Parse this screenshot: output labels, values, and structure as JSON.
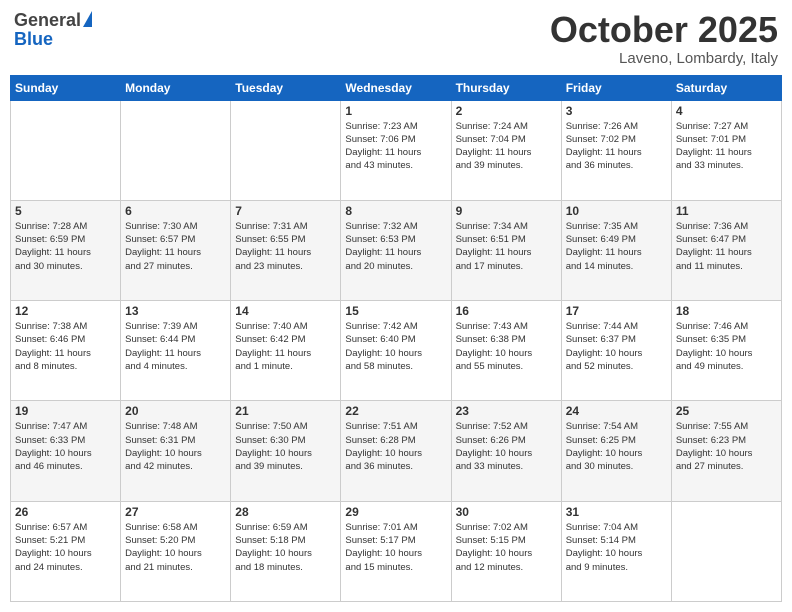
{
  "header": {
    "logo_general": "General",
    "logo_blue": "Blue",
    "month_title": "October 2025",
    "location": "Laveno, Lombardy, Italy"
  },
  "weekdays": [
    "Sunday",
    "Monday",
    "Tuesday",
    "Wednesday",
    "Thursday",
    "Friday",
    "Saturday"
  ],
  "weeks": [
    [
      {
        "day": "",
        "info": ""
      },
      {
        "day": "",
        "info": ""
      },
      {
        "day": "",
        "info": ""
      },
      {
        "day": "1",
        "info": "Sunrise: 7:23 AM\nSunset: 7:06 PM\nDaylight: 11 hours\nand 43 minutes."
      },
      {
        "day": "2",
        "info": "Sunrise: 7:24 AM\nSunset: 7:04 PM\nDaylight: 11 hours\nand 39 minutes."
      },
      {
        "day": "3",
        "info": "Sunrise: 7:26 AM\nSunset: 7:02 PM\nDaylight: 11 hours\nand 36 minutes."
      },
      {
        "day": "4",
        "info": "Sunrise: 7:27 AM\nSunset: 7:01 PM\nDaylight: 11 hours\nand 33 minutes."
      }
    ],
    [
      {
        "day": "5",
        "info": "Sunrise: 7:28 AM\nSunset: 6:59 PM\nDaylight: 11 hours\nand 30 minutes."
      },
      {
        "day": "6",
        "info": "Sunrise: 7:30 AM\nSunset: 6:57 PM\nDaylight: 11 hours\nand 27 minutes."
      },
      {
        "day": "7",
        "info": "Sunrise: 7:31 AM\nSunset: 6:55 PM\nDaylight: 11 hours\nand 23 minutes."
      },
      {
        "day": "8",
        "info": "Sunrise: 7:32 AM\nSunset: 6:53 PM\nDaylight: 11 hours\nand 20 minutes."
      },
      {
        "day": "9",
        "info": "Sunrise: 7:34 AM\nSunset: 6:51 PM\nDaylight: 11 hours\nand 17 minutes."
      },
      {
        "day": "10",
        "info": "Sunrise: 7:35 AM\nSunset: 6:49 PM\nDaylight: 11 hours\nand 14 minutes."
      },
      {
        "day": "11",
        "info": "Sunrise: 7:36 AM\nSunset: 6:47 PM\nDaylight: 11 hours\nand 11 minutes."
      }
    ],
    [
      {
        "day": "12",
        "info": "Sunrise: 7:38 AM\nSunset: 6:46 PM\nDaylight: 11 hours\nand 8 minutes."
      },
      {
        "day": "13",
        "info": "Sunrise: 7:39 AM\nSunset: 6:44 PM\nDaylight: 11 hours\nand 4 minutes."
      },
      {
        "day": "14",
        "info": "Sunrise: 7:40 AM\nSunset: 6:42 PM\nDaylight: 11 hours\nand 1 minute."
      },
      {
        "day": "15",
        "info": "Sunrise: 7:42 AM\nSunset: 6:40 PM\nDaylight: 10 hours\nand 58 minutes."
      },
      {
        "day": "16",
        "info": "Sunrise: 7:43 AM\nSunset: 6:38 PM\nDaylight: 10 hours\nand 55 minutes."
      },
      {
        "day": "17",
        "info": "Sunrise: 7:44 AM\nSunset: 6:37 PM\nDaylight: 10 hours\nand 52 minutes."
      },
      {
        "day": "18",
        "info": "Sunrise: 7:46 AM\nSunset: 6:35 PM\nDaylight: 10 hours\nand 49 minutes."
      }
    ],
    [
      {
        "day": "19",
        "info": "Sunrise: 7:47 AM\nSunset: 6:33 PM\nDaylight: 10 hours\nand 46 minutes."
      },
      {
        "day": "20",
        "info": "Sunrise: 7:48 AM\nSunset: 6:31 PM\nDaylight: 10 hours\nand 42 minutes."
      },
      {
        "day": "21",
        "info": "Sunrise: 7:50 AM\nSunset: 6:30 PM\nDaylight: 10 hours\nand 39 minutes."
      },
      {
        "day": "22",
        "info": "Sunrise: 7:51 AM\nSunset: 6:28 PM\nDaylight: 10 hours\nand 36 minutes."
      },
      {
        "day": "23",
        "info": "Sunrise: 7:52 AM\nSunset: 6:26 PM\nDaylight: 10 hours\nand 33 minutes."
      },
      {
        "day": "24",
        "info": "Sunrise: 7:54 AM\nSunset: 6:25 PM\nDaylight: 10 hours\nand 30 minutes."
      },
      {
        "day": "25",
        "info": "Sunrise: 7:55 AM\nSunset: 6:23 PM\nDaylight: 10 hours\nand 27 minutes."
      }
    ],
    [
      {
        "day": "26",
        "info": "Sunrise: 6:57 AM\nSunset: 5:21 PM\nDaylight: 10 hours\nand 24 minutes."
      },
      {
        "day": "27",
        "info": "Sunrise: 6:58 AM\nSunset: 5:20 PM\nDaylight: 10 hours\nand 21 minutes."
      },
      {
        "day": "28",
        "info": "Sunrise: 6:59 AM\nSunset: 5:18 PM\nDaylight: 10 hours\nand 18 minutes."
      },
      {
        "day": "29",
        "info": "Sunrise: 7:01 AM\nSunset: 5:17 PM\nDaylight: 10 hours\nand 15 minutes."
      },
      {
        "day": "30",
        "info": "Sunrise: 7:02 AM\nSunset: 5:15 PM\nDaylight: 10 hours\nand 12 minutes."
      },
      {
        "day": "31",
        "info": "Sunrise: 7:04 AM\nSunset: 5:14 PM\nDaylight: 10 hours\nand 9 minutes."
      },
      {
        "day": "",
        "info": ""
      }
    ]
  ]
}
